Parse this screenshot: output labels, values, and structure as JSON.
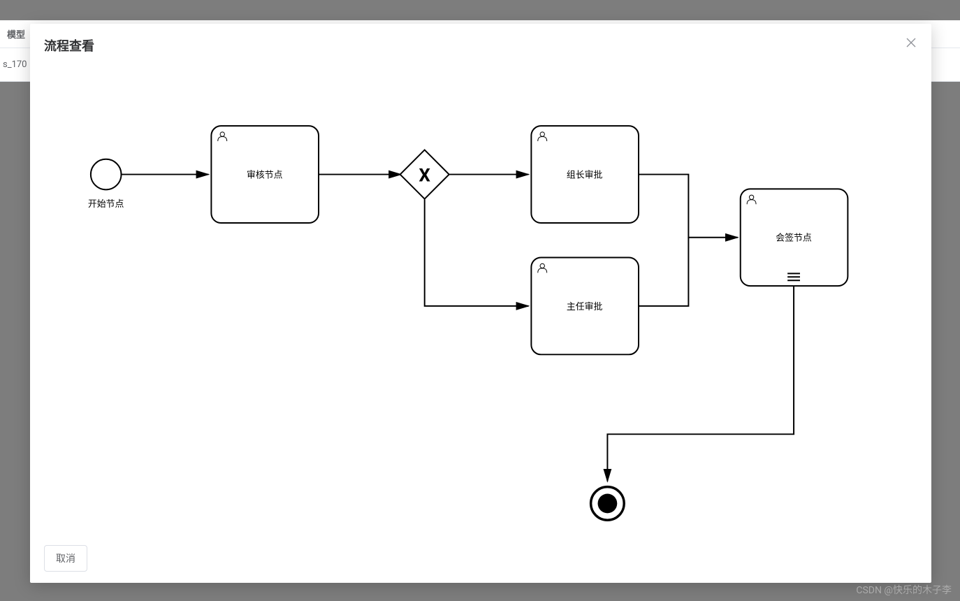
{
  "background": {
    "header_col1": "模型",
    "row1_text": "s_170"
  },
  "modal": {
    "title": "流程查看",
    "close_label": "×",
    "cancel_label": "取消"
  },
  "diagram": {
    "start_event": {
      "label": "开始节点"
    },
    "task_review": {
      "label": "审核节点"
    },
    "gateway_exclusive": {
      "symbol": "X"
    },
    "task_leader": {
      "label": "组长审批"
    },
    "task_director": {
      "label": "主任审批"
    },
    "task_countersign": {
      "label": "会签节点"
    },
    "end_event": {
      "label": ""
    }
  },
  "watermark": "CSDN @快乐的木子李"
}
